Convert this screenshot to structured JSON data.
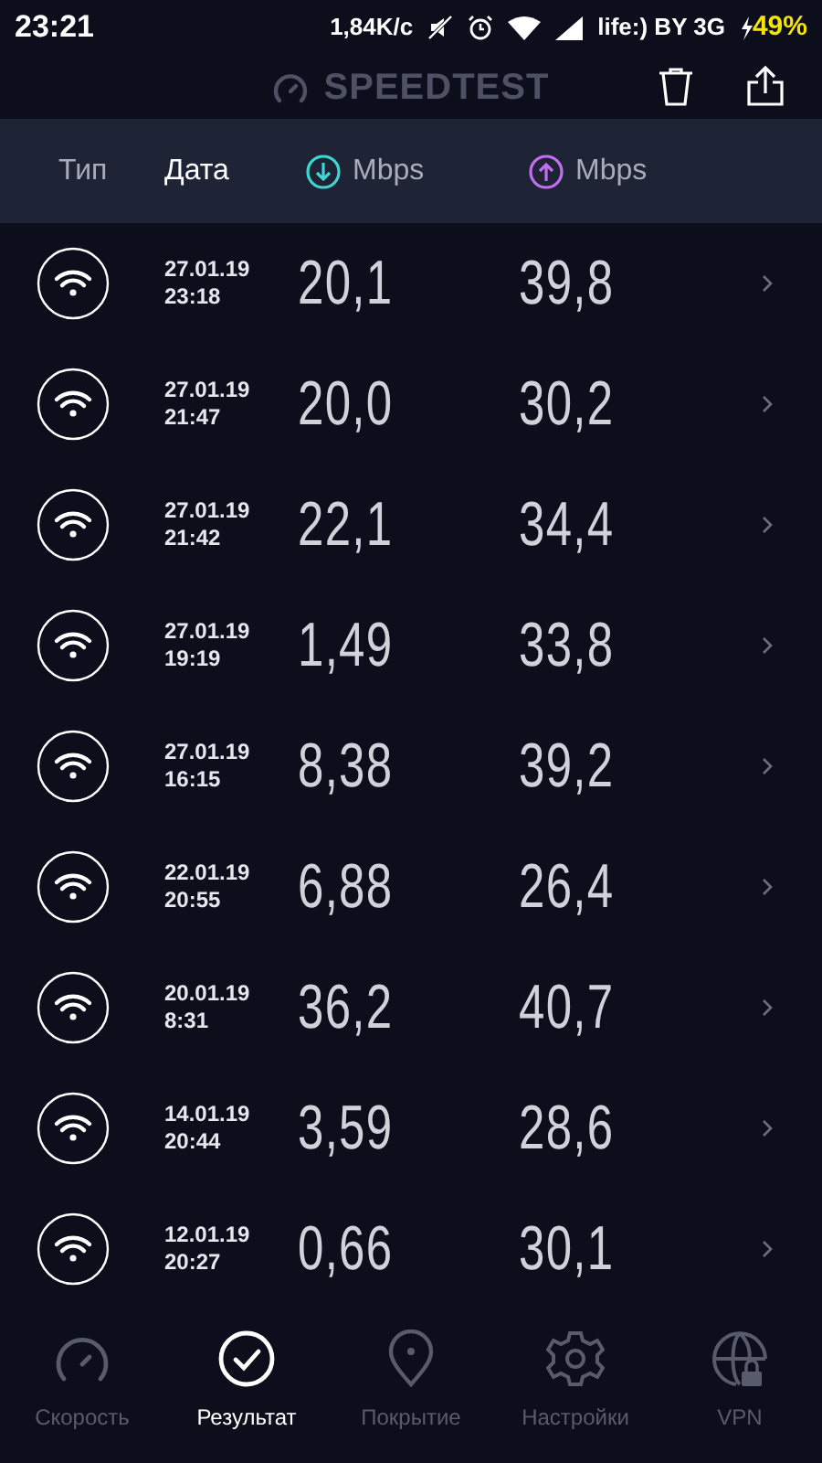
{
  "status_bar": {
    "time": "23:21",
    "speed": "1,84K/c",
    "carrier": "life:) BY 3G",
    "battery": "49%"
  },
  "header": {
    "title": "SPEEDTEST"
  },
  "columns": [
    {
      "kind": "text",
      "label": "Тип",
      "selected": false
    },
    {
      "kind": "text",
      "label": "Дата",
      "selected": true
    },
    {
      "kind": "download",
      "label": "Mbps",
      "selected": false
    },
    {
      "kind": "upload",
      "label": "Mbps",
      "selected": false
    }
  ],
  "results": [
    {
      "date": "27.01.19",
      "time": "23:18",
      "download": "20,1",
      "upload": "39,8"
    },
    {
      "date": "27.01.19",
      "time": "21:47",
      "download": "20,0",
      "upload": "30,2"
    },
    {
      "date": "27.01.19",
      "time": "21:42",
      "download": "22,1",
      "upload": "34,4"
    },
    {
      "date": "27.01.19",
      "time": "19:19",
      "download": "1,49",
      "upload": "33,8"
    },
    {
      "date": "27.01.19",
      "time": "16:15",
      "download": "8,38",
      "upload": "39,2"
    },
    {
      "date": "22.01.19",
      "time": "20:55",
      "download": "6,88",
      "upload": "26,4"
    },
    {
      "date": "20.01.19",
      "time": "8:31",
      "download": "36,2",
      "upload": "40,7"
    },
    {
      "date": "14.01.19",
      "time": "20:44",
      "download": "3,59",
      "upload": "28,6"
    },
    {
      "date": "12.01.19",
      "time": "20:27",
      "download": "0,66",
      "upload": "30,1"
    }
  ],
  "nav": [
    {
      "kind": "speed",
      "label": "Скорость",
      "selected": false
    },
    {
      "kind": "results",
      "label": "Результат",
      "selected": true
    },
    {
      "kind": "coverage",
      "label": "Покрытие",
      "selected": false
    },
    {
      "kind": "settings",
      "label": "Настройки",
      "selected": false
    },
    {
      "kind": "vpn",
      "label": "VPN",
      "selected": false
    }
  ]
}
